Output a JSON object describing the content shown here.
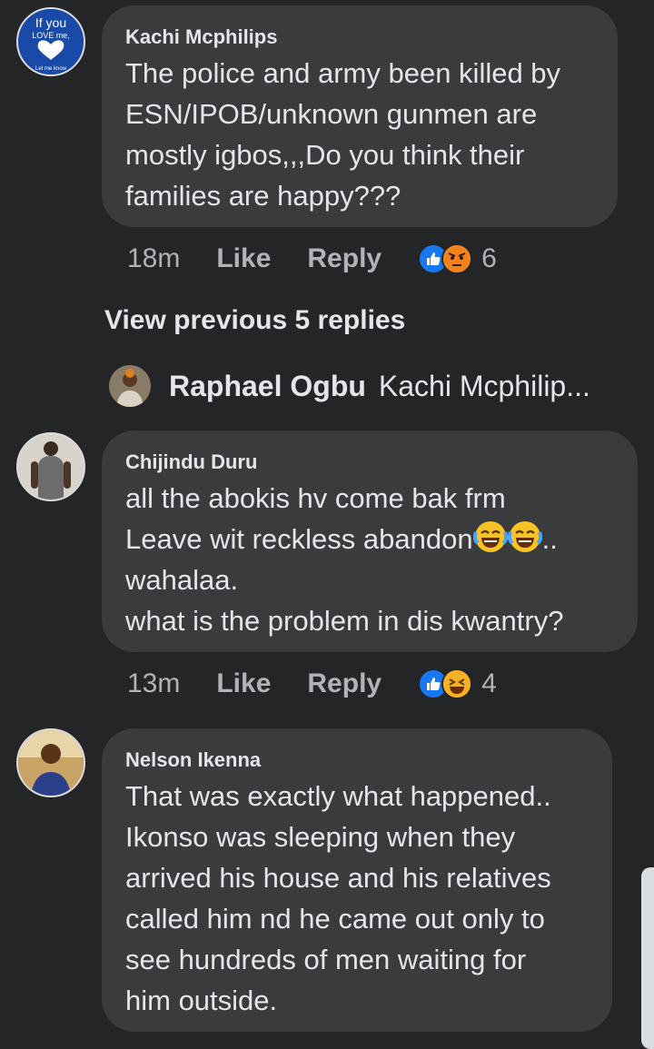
{
  "colors": {
    "background": "#242526",
    "bubble": "#3a3b3c",
    "like_blue": "#1877f2",
    "angry": "#e9710f",
    "haha": "#f7b125"
  },
  "comments": [
    {
      "author": "Kachi Mcphilips",
      "avatar_text": [
        "If you",
        "LOVE me,",
        "Let me know"
      ],
      "lines": [
        "The police and army been killed by",
        "ESN/IPOB/unknown gunmen  are",
        "mostly  igbos,,,Do you  think their",
        "families are happy???"
      ],
      "time": "18m",
      "like": "Like",
      "reply": "Reply",
      "reactions": [
        "like-icon",
        "angry-icon"
      ],
      "reaction_count": "6"
    },
    {
      "author": "Chijindu Duru",
      "lines": [
        "all the abokis hv come bak frm",
        "Leave wit reckless abandon",
        "wahalaa.",
        "what  is the problem in dis kwantry?"
      ],
      "line2_suffix": "..",
      "time": "13m",
      "like": "Like",
      "reply": "Reply",
      "reactions": [
        "like-icon",
        "haha-icon"
      ],
      "reaction_count": "4"
    },
    {
      "author": "Nelson Ikenna",
      "lines": [
        "That was exactly what happened..",
        "Ikonso was sleeping when they",
        "arrived his house and his relatives",
        "called him nd he came out only to",
        "see hundreds of men waiting for",
        "him outside."
      ]
    }
  ],
  "view_previous": "View previous 5 replies",
  "latest_reply": {
    "author": "Raphael Ogbu",
    "snippet": "Kachi Mcphilip..."
  }
}
